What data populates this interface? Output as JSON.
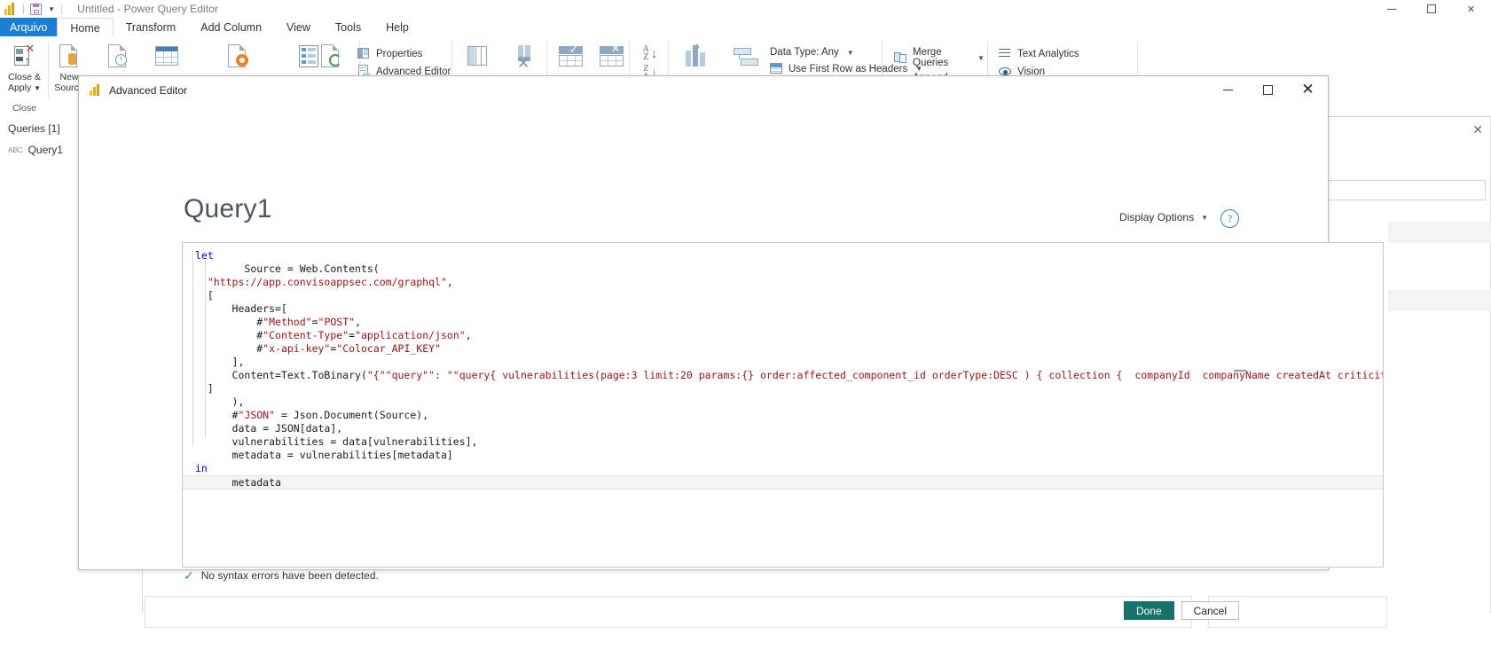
{
  "titlebar": {
    "logo_icon": "power-bi-logo",
    "save_icon": "save-icon",
    "caret_icon": "chevron-down-icon",
    "title": "Untitled - Power Query Editor",
    "minimize_icon": "minimize-icon",
    "maximize_icon": "maximize-icon",
    "close_icon": "close-icon"
  },
  "ribbon": {
    "tabs": [
      {
        "label": "Arquivo"
      },
      {
        "label": "Home"
      },
      {
        "label": "Transform"
      },
      {
        "label": "Add Column"
      },
      {
        "label": "View"
      },
      {
        "label": "Tools"
      },
      {
        "label": "Help"
      }
    ],
    "groups": [
      {
        "label": "Close"
      },
      {
        "label": ""
      },
      {
        "label": ""
      },
      {
        "label": ""
      },
      {
        "label": ""
      },
      {
        "label": ""
      }
    ],
    "close_apply": {
      "line1": "Close &",
      "line2": "Apply",
      "icon": "close-and-apply-icon"
    },
    "new_source": {
      "line1": "New",
      "line2": "Source",
      "icon": "new-source-icon"
    },
    "recent_sources": {
      "icon": "recent-sources-icon"
    },
    "enter_data": {
      "icon": "enter-data-icon"
    },
    "data_source_settings": {
      "icon": "data-source-settings-icon"
    },
    "manage_parameters": {
      "icon": "manage-parameters-icon"
    },
    "refresh_preview": {
      "icon": "refresh-preview-icon"
    },
    "properties": {
      "label": "Properties",
      "icon": "properties-icon"
    },
    "advanced_editor": {
      "label": "Advanced Editor",
      "icon": "advanced-editor-icon"
    },
    "choose_columns": {
      "icon": "choose-columns-icon"
    },
    "remove_columns": {
      "icon": "remove-columns-icon"
    },
    "keep_rows": {
      "icon": "keep-rows-icon"
    },
    "remove_rows": {
      "icon": "remove-rows-icon"
    },
    "sort_asc": {
      "icon": "sort-ascending-icon"
    },
    "sort_desc": {
      "icon": "sort-descending-icon"
    },
    "split_column": {
      "icon": "split-column-icon"
    },
    "group_by": {
      "icon": "group-by-icon"
    },
    "data_type": {
      "label": "Data Type: Any",
      "icon": "data-type-icon"
    },
    "use_first_row": {
      "label": "Use First Row as Headers",
      "icon": "use-first-row-icon"
    },
    "merge_queries": {
      "label": "Merge Queries",
      "icon": "merge-queries-icon"
    },
    "append_queries": {
      "label": "Append Queries",
      "icon": "append-queries-icon"
    },
    "text_analytics": {
      "label": "Text Analytics",
      "icon": "text-analytics-icon"
    },
    "vision": {
      "label": "Vision",
      "icon": "vision-icon"
    }
  },
  "queries_pane": {
    "header": "Queries [1]",
    "items": [
      {
        "label": "Query1",
        "type_icon": "abc-text-icon"
      }
    ]
  },
  "right_pane": {
    "close_icon": "close-icon"
  },
  "dialog": {
    "logo_icon": "power-bi-logo",
    "title": "Advanced Editor",
    "minimize_icon": "minimize-icon",
    "maximize_icon": "maximize-icon",
    "close_icon": "close-icon",
    "query_name": "Query1",
    "display_options_label": "Display Options",
    "display_options_caret": "chevron-down-icon",
    "help_icon": "help-icon",
    "help_glyph": "?",
    "status": {
      "check_icon": "checkmark-icon",
      "check_glyph": "✓",
      "message": "No syntax errors have been detected."
    },
    "done_button": "Done",
    "cancel_button": "Cancel",
    "code_lines": [
      {
        "indent": 0,
        "segments": [
          {
            "t": "let",
            "c": "kw"
          }
        ]
      },
      {
        "indent": 4,
        "segments": [
          {
            "t": "Source = Web.Contents(",
            "c": "pun"
          }
        ]
      },
      {
        "indent": 1,
        "segments": [
          {
            "t": "\"https://app.convisoappsec.com/graphql\"",
            "c": "str"
          },
          {
            "t": ",",
            "c": "pun"
          }
        ]
      },
      {
        "indent": 1,
        "segments": [
          {
            "t": "[",
            "c": "pun"
          }
        ]
      },
      {
        "indent": 3,
        "segments": [
          {
            "t": "Headers=[",
            "c": "pun"
          }
        ]
      },
      {
        "indent": 5,
        "segments": [
          {
            "t": "#",
            "c": "pun"
          },
          {
            "t": "\"Method\"",
            "c": "str"
          },
          {
            "t": "=",
            "c": "pun"
          },
          {
            "t": "\"POST\"",
            "c": "str"
          },
          {
            "t": ",",
            "c": "pun"
          }
        ]
      },
      {
        "indent": 5,
        "segments": [
          {
            "t": "#",
            "c": "pun"
          },
          {
            "t": "\"Content-Type\"",
            "c": "str"
          },
          {
            "t": "=",
            "c": "pun"
          },
          {
            "t": "\"application/json\"",
            "c": "str"
          },
          {
            "t": ",",
            "c": "pun"
          }
        ]
      },
      {
        "indent": 5,
        "segments": [
          {
            "t": "#",
            "c": "pun"
          },
          {
            "t": "\"x-api-key\"",
            "c": "str"
          },
          {
            "t": "=",
            "c": "pun"
          },
          {
            "t": "\"Colocar_API_KEY\"",
            "c": "str"
          }
        ]
      },
      {
        "indent": 3,
        "segments": [
          {
            "t": "],",
            "c": "pun"
          }
        ]
      },
      {
        "indent": 3,
        "segments": [
          {
            "t": "Content=Text.ToBinary(",
            "c": "pun"
          },
          {
            "t": "\"{\"\"query\"\": \"\"query{ vulnerabilities(page:3 limit:20 params:{} order:affected_component_id orderType:DESC ) { collection {  companyId  companyName createdAt criticity failureType id impact i",
            "c": "str"
          }
        ]
      },
      {
        "indent": 1,
        "segments": [
          {
            "t": "]",
            "c": "pun"
          }
        ]
      },
      {
        "indent": 3,
        "segments": [
          {
            "t": "),",
            "c": "pun"
          }
        ]
      },
      {
        "indent": 3,
        "segments": [
          {
            "t": "#",
            "c": "pun"
          },
          {
            "t": "\"JSON\"",
            "c": "str"
          },
          {
            "t": " = Json.Document(Source),",
            "c": "pun"
          }
        ]
      },
      {
        "indent": 3,
        "segments": [
          {
            "t": "data = JSON[data],",
            "c": "pun"
          }
        ]
      },
      {
        "indent": 3,
        "segments": [
          {
            "t": "vulnerabilities = data[vulnerabilities],",
            "c": "pun"
          }
        ]
      },
      {
        "indent": 3,
        "segments": [
          {
            "t": "metadata = vulnerabilities[metadata]",
            "c": "pun"
          }
        ]
      },
      {
        "indent": 0,
        "segments": [
          {
            "t": "in",
            "c": "kw"
          }
        ]
      },
      {
        "indent": 3,
        "current": true,
        "segments": [
          {
            "t": "metadata",
            "c": "pun"
          }
        ]
      }
    ]
  },
  "colors": {
    "accent_blue": "#1a7fd4",
    "done_green": "#16726a",
    "keyword": "#0000ff",
    "string": "#a31515",
    "status_check": "#2e9e5b"
  }
}
